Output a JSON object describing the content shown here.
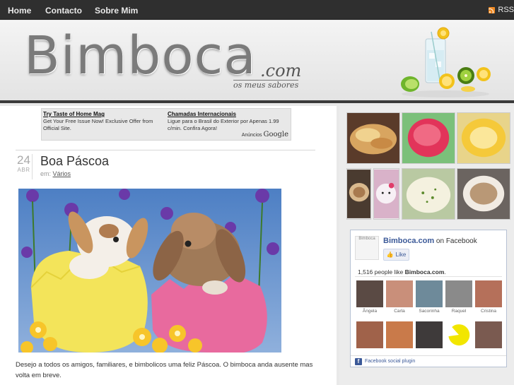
{
  "nav": {
    "items": [
      {
        "label": "Home"
      },
      {
        "label": "Contacto"
      },
      {
        "label": "Sobre Mim"
      }
    ],
    "rss_label": "RSS"
  },
  "header": {
    "logo": "Bimboca",
    "logo_suffix": ".com",
    "tagline": "os meus sabores"
  },
  "ad": {
    "left": {
      "title": "Try Taste of Home Mag",
      "body": "Get Your Free Issue Now! Exclusive Offer from Official Site."
    },
    "right": {
      "title": "Chamadas Internacionais",
      "body": "Ligue para o Brasil do Exterior por Apenas 1.99 c/min. Confira Agora!"
    },
    "footer_label": "Anúncios",
    "footer_brand": "Google"
  },
  "post": {
    "day": "24",
    "month": "ABR",
    "title": "Boa Páscoa",
    "category_prefix": "em",
    "category": "Vários",
    "body": "Desejo a todos os amigos, familiares, e bimbolicos uma feliz Páscoa. O bimboca anda ausente mas volta em breve."
  },
  "facebook": {
    "box_logo_text": "Bimboca",
    "page_name": "Bimboca.com",
    "on_text": "on Facebook",
    "like_label": "Like",
    "count_text": "1,516 people like",
    "count_name": "Bimboca.com",
    "fans": [
      "Ângela",
      "Carla",
      "Sacorinha",
      "Raquel",
      "Cristina",
      "",
      "",
      "",
      "",
      ""
    ],
    "plugin_label": "Facebook social plugin"
  },
  "colors": {
    "nav_bg": "#2f2f2f",
    "header_bar": "#3a3a3a",
    "fb_blue": "#3b5998"
  }
}
